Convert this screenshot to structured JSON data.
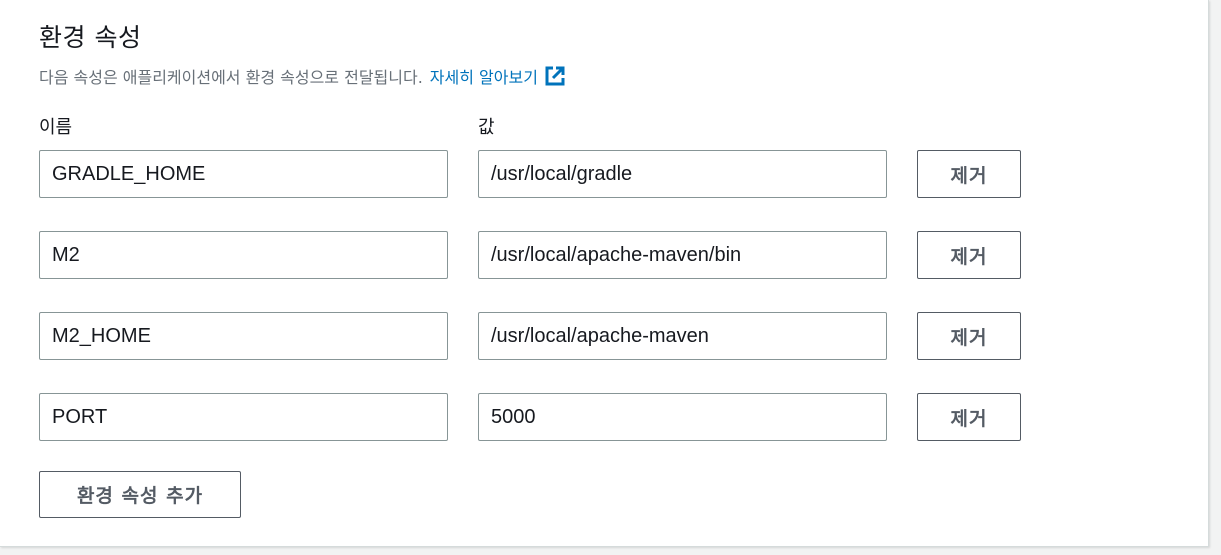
{
  "section": {
    "title": "환경 속성",
    "description": "다음 속성은 애플리케이션에서 환경 속성으로 전달됩니다.",
    "learn_more_link": "자세히 알아보기"
  },
  "columns": {
    "name_label": "이름",
    "value_label": "값"
  },
  "properties": [
    {
      "name": "GRADLE_HOME",
      "value": "/usr/local/gradle",
      "remove_label": "제거"
    },
    {
      "name": "M2",
      "value": "/usr/local/apache-maven/bin",
      "remove_label": "제거"
    },
    {
      "name": "M2_HOME",
      "value": "/usr/local/apache-maven",
      "remove_label": "제거"
    },
    {
      "name": "PORT",
      "value": "5000",
      "remove_label": "제거"
    }
  ],
  "add_button_label": "환경 속성 추가",
  "colors": {
    "link": "#0073bb",
    "description": "#687078",
    "border": "#879596"
  },
  "icons": {
    "external_link": "external-link-icon"
  }
}
